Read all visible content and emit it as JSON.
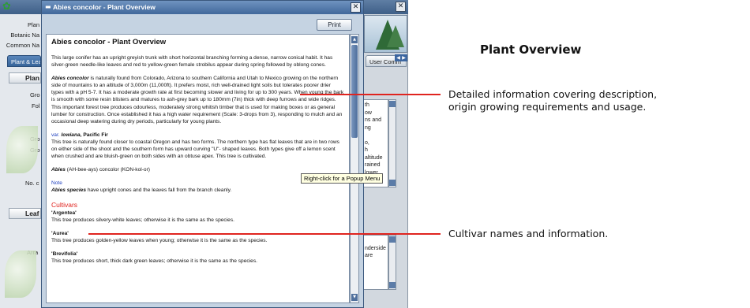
{
  "background_app": {
    "field_labels": [
      "Plan",
      "Botanic Na",
      "Common Na"
    ],
    "tab_label": "Plant & Lea",
    "panel_plant": "Plan",
    "panel_leaf": "Leaf",
    "side_labels": [
      "Gro",
      "Fol",
      "Gro",
      "Gro",
      "No. c",
      "Arra"
    ],
    "user_tab": "User Comm",
    "textbox_top": "th\now\nns and\nng\n\no,\nh\naltitude\nrained\nlower",
    "textbox_bottom": "\nnderside\nare"
  },
  "popup": {
    "title": "Abies concolor - Plant Overview",
    "print_label": "Print",
    "heading": "Abies concolor - Plant Overview",
    "p1": "This large conifer has an upright greyish trunk with short horizontal branching forming a dense, narrow conical habit. It has silver-green needle-like leaves and red to yellow-green female strobilus appear during spring followed by oblong cones.",
    "p2_name": "Abies concolor",
    "p2_text": " is naturally found from Colorado, Arizona to southern California and Utah to Mexico growing on the northern side of mountains to an altitude of 3,000m (11,000ft). It prefers moist, rich well-drained light soils but tolerates poorer drier types with a pH 5-7. It has a moderate growth rate at first becoming slower and living for up to 300 years. When young the bark is smooth with some resin blisters and matures to ash-grey bark up to 180mm (7in) thick with deep furrows and wide ridges.",
    "p3": "This important forest tree produces odourless, moderately strong whitish timber that is used for making boxes or as general lumber for construction. Once established it has a high water requirement (Scale: 3-drops from 3), responding to mulch and an occasional deep watering during dry periods, particularly for young plants.",
    "var_prefix": "var. ",
    "var_name": "lowiana",
    "var_suffix": ", Pacific Fir",
    "p4": "This tree is naturally found closer to coastal Oregon and has two forms. The northern type has flat leaves that are in two rows on either side of the shoot and the southern form has upward curving \"U\"- shaped leaves. Both types give off a lemon scent when crushed and are bluish-green on both sides with an obtuse apex. This tree is cultivated.",
    "pron_name": "Abies",
    "pron_text": " (AH-bee-ays) concolor (KON-kol-or)",
    "note_label": "Note",
    "note_name": "Abies species",
    "note_text": " have upright cones and the leaves fall from the branch cleanly.",
    "cultivars_heading": "Cultivars",
    "cultivars": [
      {
        "name": "'Argentea'",
        "desc": "This tree produces silvery-white leaves; otherwise it is the same as the species."
      },
      {
        "name": "'Aurea'",
        "desc": "This tree produces golden-yellow leaves when young; otherwise it is the same as the species."
      },
      {
        "name": "'Brevifolia'",
        "desc": "This tree produces short, thick dark green leaves; otherwise it is the same as the species."
      }
    ],
    "tooltip": "Right-click for a Popup Menu"
  },
  "annotations": {
    "title": "Plant Overview",
    "overview_text": "Detailed information covering description,\norigin growing requirements and usage.",
    "cultivar_text": "Cultivar names and information.",
    "line_color": "#e0241f"
  }
}
